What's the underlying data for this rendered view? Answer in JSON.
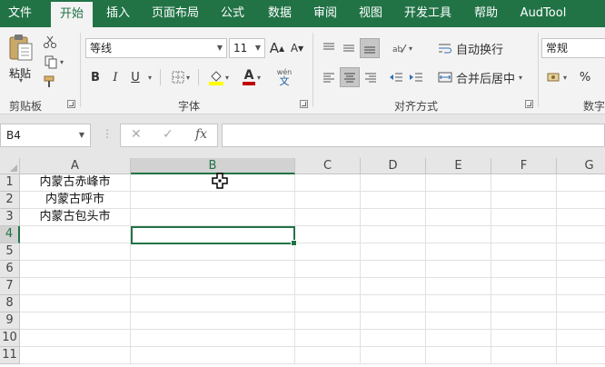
{
  "menu": {
    "tabs": [
      "文件",
      "开始",
      "插入",
      "页面布局",
      "公式",
      "数据",
      "审阅",
      "视图",
      "开发工具",
      "帮助",
      "AudTool"
    ],
    "active_index": 1
  },
  "ribbon": {
    "clipboard": {
      "label": "剪贴板",
      "paste_label": "粘贴"
    },
    "font": {
      "label": "字体",
      "font_name": "等线",
      "font_size": "11",
      "grow_label": "A",
      "shrink_label": "A",
      "bold": "B",
      "italic": "I",
      "underline": "U",
      "font_color_glyph": "A",
      "phonetic_top": "wén",
      "phonetic_bottom": "文"
    },
    "alignment": {
      "label": "对齐方式",
      "wrap_text": "自动换行",
      "merge_center": "合并后居中"
    },
    "number": {
      "label": "数字",
      "format": "常规",
      "percent": "%"
    }
  },
  "formula_bar": {
    "name_box": "B4",
    "cancel_glyph": "✕",
    "enter_glyph": "✓",
    "fx_glyph": "fx",
    "formula": ""
  },
  "sheet": {
    "columns": [
      "A",
      "B",
      "C",
      "D",
      "E",
      "F",
      "G"
    ],
    "selected_column": "B",
    "rows": [
      "1",
      "2",
      "3",
      "4",
      "5",
      "6",
      "7",
      "8",
      "9",
      "10",
      "11"
    ],
    "selected_row": "4",
    "cells": {
      "A1": "内蒙古赤峰市",
      "A2": "内蒙古呼市",
      "A3": "内蒙古包头市"
    },
    "active_cell": "B4"
  },
  "colors": {
    "accent": "#217346",
    "ribbon_bg": "#f3f3f3",
    "header_bg": "#e6e6e6",
    "gridline": "#e1e1e1"
  }
}
